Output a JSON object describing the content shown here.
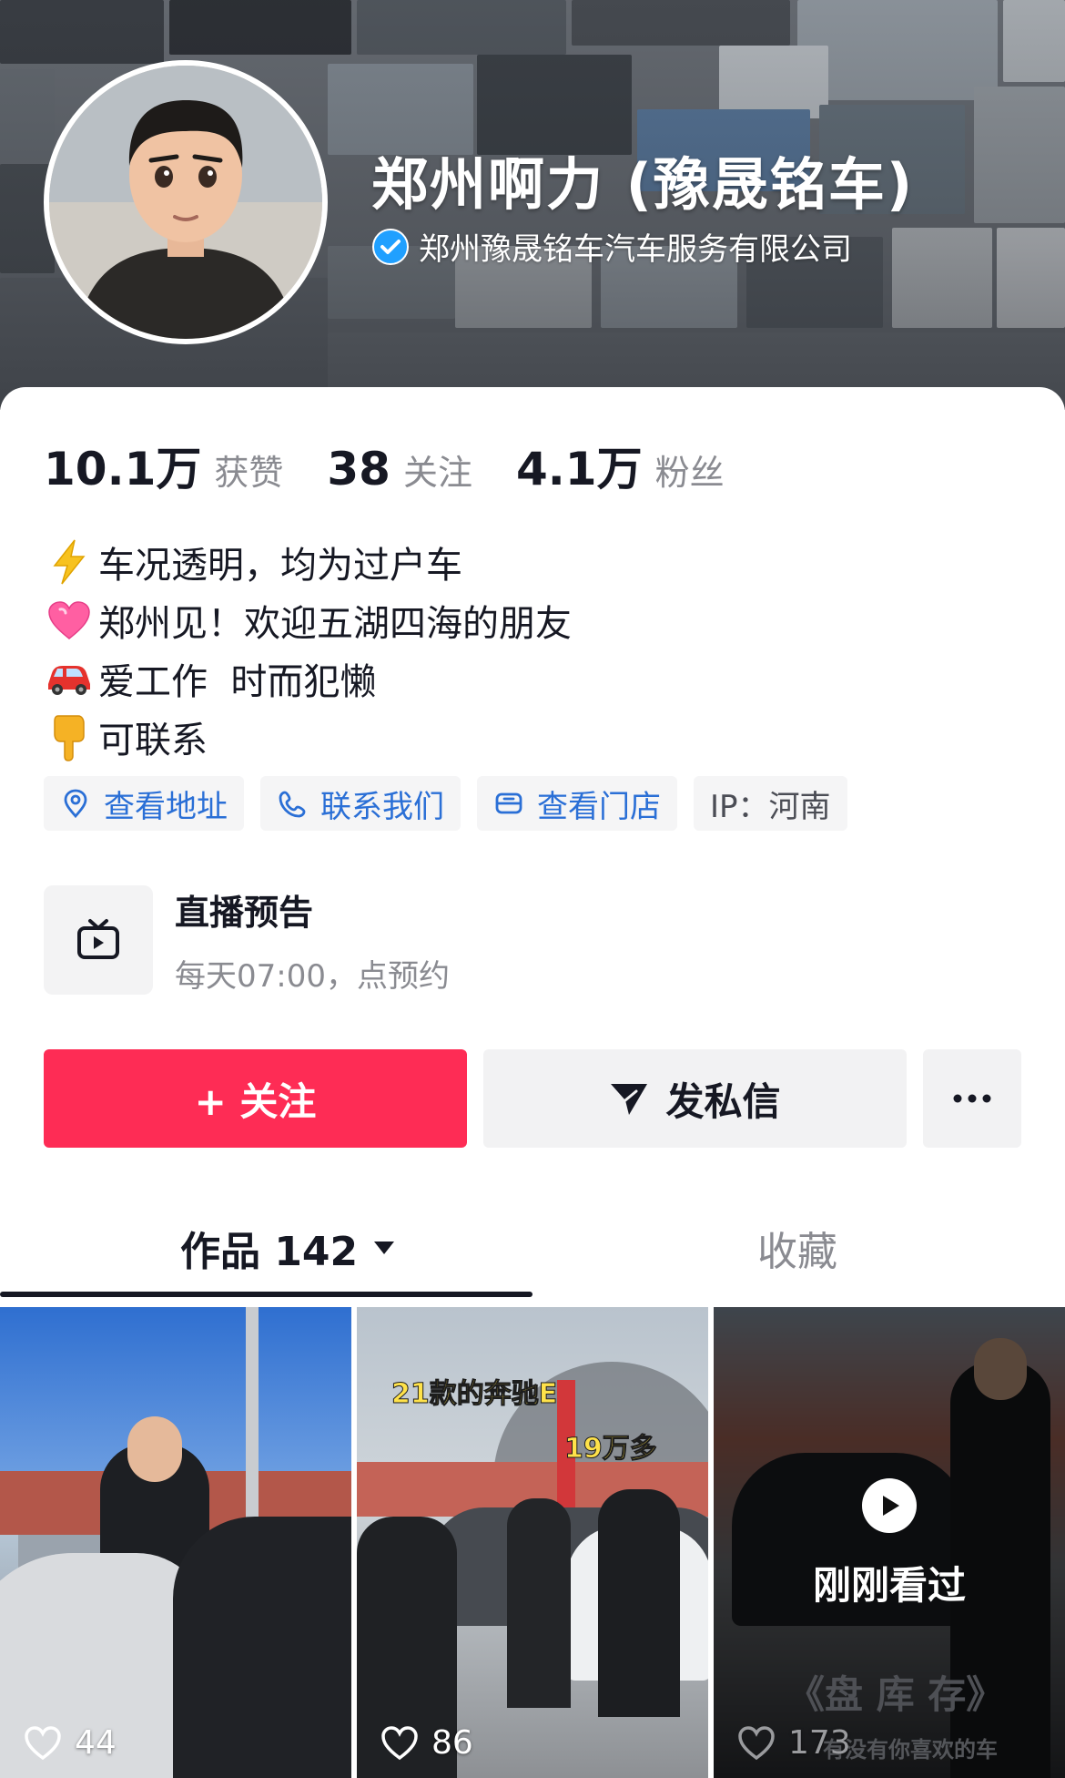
{
  "header": {
    "name": "郑州啊力 (豫晟铭车)",
    "company": "郑州豫晟铭车汽车服务有限公司",
    "verified_icon": "verified-badge-icon"
  },
  "stats": [
    {
      "value": "10.1万",
      "label": "获赞"
    },
    {
      "value": "38",
      "label": "关注"
    },
    {
      "value": "4.1万",
      "label": "粉丝"
    }
  ],
  "bio": [
    {
      "icon": "lightning-emoji",
      "text": "车况透明，均为过户车"
    },
    {
      "icon": "heart-emoji",
      "text": "郑州见！欢迎五湖四海的朋友"
    },
    {
      "icon": "car-emoji",
      "text": "爱工作  时而犯懒"
    },
    {
      "icon": "pointing-down-emoji",
      "text": "可联系"
    }
  ],
  "chips": [
    {
      "icon": "location-pin-icon",
      "label": "查看地址"
    },
    {
      "icon": "phone-link-icon",
      "label": "联系我们"
    },
    {
      "icon": "store-icon",
      "label": "查看门店"
    },
    {
      "label": "IP：河南"
    }
  ],
  "live": {
    "icon": "tv-icon",
    "title": "直播预告",
    "subtitle": "每天07:00，点预约"
  },
  "actions": {
    "follow": "+ 关注",
    "message": "发私信",
    "more_icon": "more-dots-icon"
  },
  "tabs": {
    "works": "作品 142",
    "favorites": "收藏"
  },
  "videos": [
    {
      "likes": "44"
    },
    {
      "likes": "86",
      "caption_1": "21款的奔驰E",
      "caption_2": "19万多"
    },
    {
      "likes": "173",
      "watched": "刚刚看过",
      "caption_1": "《盘 库 存》",
      "caption_2": "有没有你喜欢的车"
    }
  ],
  "colors": {
    "accent": "#fe2c55",
    "link": "#2a6fd6",
    "verified": "#20a0ff"
  }
}
